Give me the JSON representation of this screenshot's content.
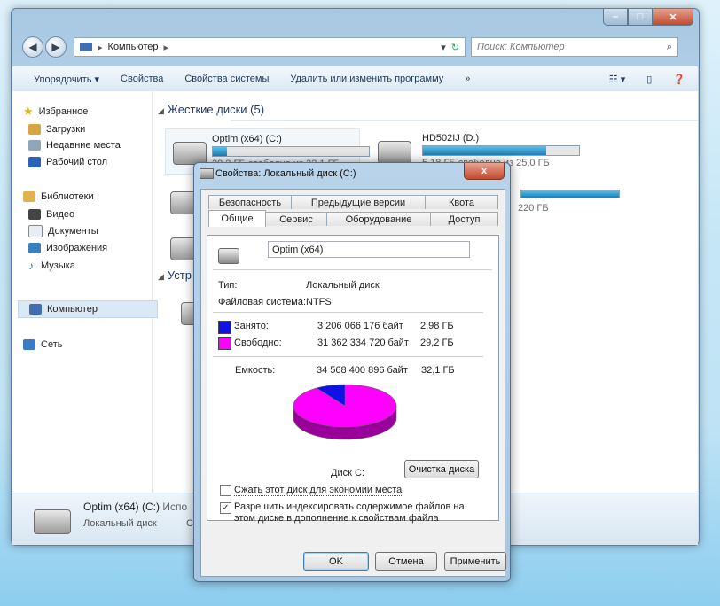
{
  "explorer": {
    "breadcrumb": "Компьютер",
    "search_placeholder": "Поиск: Компьютер",
    "toolbar": {
      "organize": "Упорядочить ▾",
      "properties": "Свойства",
      "system_properties": "Свойства системы",
      "uninstall": "Удалить или изменить программу",
      "more": "»"
    },
    "nav": {
      "favorites": "Избранное",
      "downloads": "Загрузки",
      "recent": "Недавние места",
      "desktop": "Рабочий стол",
      "libraries": "Библиотеки",
      "video": "Видео",
      "documents": "Документы",
      "pictures": "Изображения",
      "music": "Музыка",
      "computer": "Компьютер",
      "network": "Сеть"
    },
    "hard_drives_header": "Жесткие диски (5)",
    "devices_header": "Устр",
    "drives": [
      {
        "name": "Optim (x64) (C:)",
        "free": "29,2 ГБ свободно из 32,1 ГБ",
        "used_fraction": 0.09
      },
      {
        "name": "HD502IJ (D:)",
        "free": "5,18 ГБ свободно из 25,0 ГБ",
        "used_fraction": 0.79
      }
    ],
    "partial_free_text": "220 ГБ",
    "details": {
      "name": "Optim (x64) (C:)",
      "name_suffix": "Испо",
      "type": "Локальный диск",
      "type_suffix": "С"
    }
  },
  "dialog": {
    "title": "Свойства: Локальный диск (C:)",
    "close_label": "x",
    "tabs_row1": [
      "Безопасность",
      "Предыдущие версии",
      "Квота"
    ],
    "tabs_row2": [
      "Общие",
      "Сервис",
      "Оборудование",
      "Доступ"
    ],
    "volume_label": "Optim (x64)",
    "type_label": "Тип:",
    "type_value": "Локальный диск",
    "fs_label": "Файловая система:",
    "fs_value": "NTFS",
    "used_label": "Занято:",
    "used_bytes": "3 206 066 176 байт",
    "used_gb": "2,98 ГБ",
    "free_label": "Свободно:",
    "free_bytes": "31 362 334 720 байт",
    "free_gb": "29,2 ГБ",
    "capacity_label": "Емкость:",
    "capacity_bytes": "34 568 400 896 байт",
    "capacity_gb": "32,1 ГБ",
    "disk_label": "Диск C:",
    "cleanup_button": "Очистка диска",
    "compress_checkbox": "Сжать этот диск для экономии места",
    "compress_checked": false,
    "index_checkbox": "Разрешить индексировать содержимое файлов на этом диске в дополнение к свойствам файла",
    "index_checked": true,
    "ok_button": "OK",
    "cancel_button": "Отмена",
    "apply_button": "Применить",
    "colors": {
      "used": "#1010e8",
      "free": "#ff00ff"
    },
    "pie": {
      "used_fraction": 0.0927,
      "free_fraction": 0.9073
    }
  }
}
